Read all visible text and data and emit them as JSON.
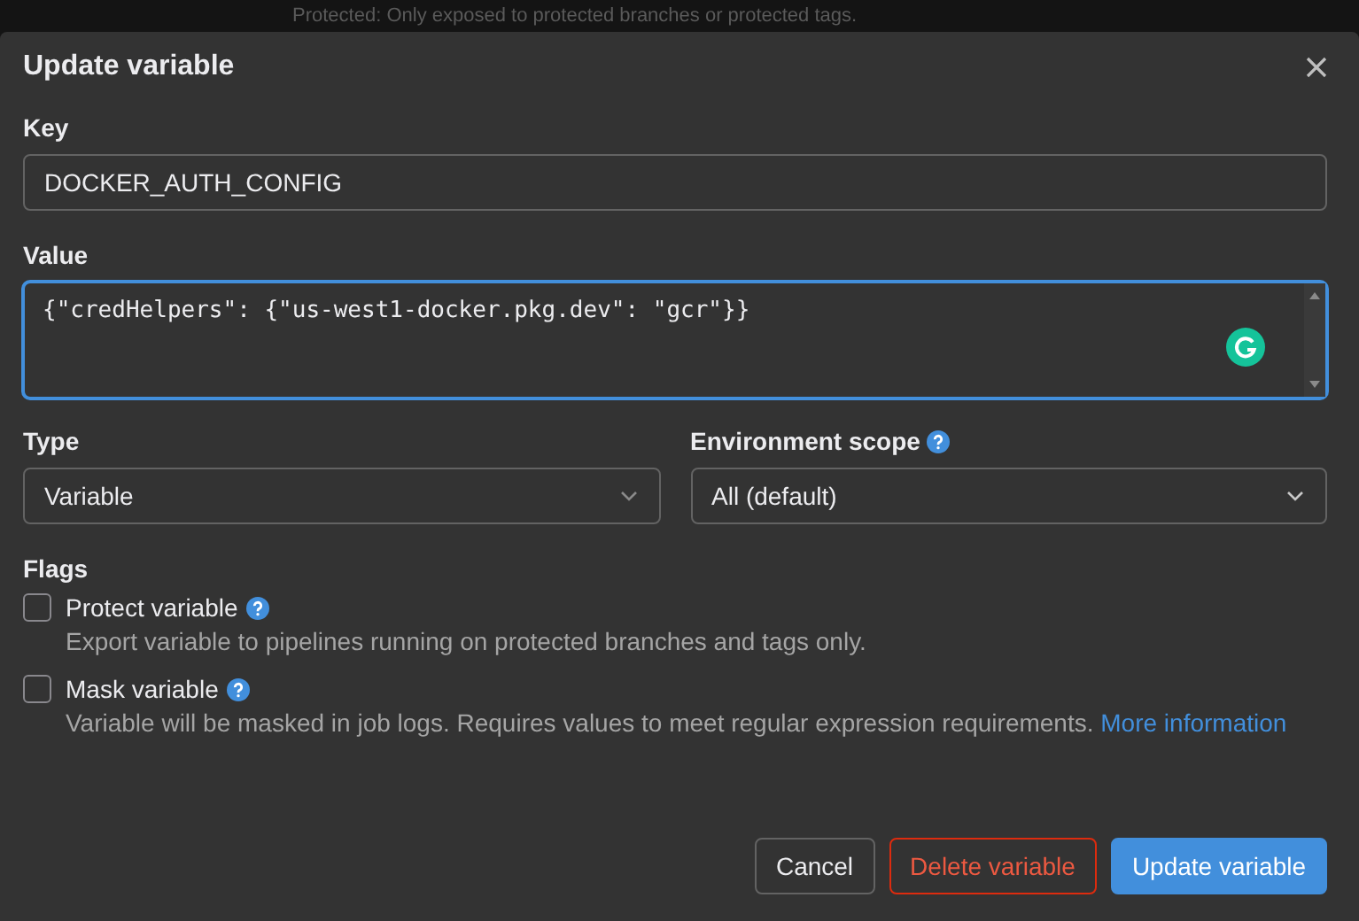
{
  "background_text": "Protected: Only exposed to protected branches or protected tags.",
  "dialog": {
    "title": "Update variable",
    "key": {
      "label": "Key",
      "value": "DOCKER_AUTH_CONFIG"
    },
    "value": {
      "label": "Value",
      "value": "{\"credHelpers\": {\"us-west1-docker.pkg.dev\": \"gcr\"}}"
    },
    "type": {
      "label": "Type",
      "value": "Variable"
    },
    "environment_scope": {
      "label": "Environment scope",
      "value": "All (default)"
    },
    "flags": {
      "label": "Flags",
      "items": [
        {
          "label": "Protect variable",
          "checked": false,
          "description": "Export variable to pipelines running on protected branches and tags only."
        },
        {
          "label": "Mask variable",
          "checked": false,
          "description": "Variable will be masked in job logs. Requires values to meet regular expression requirements.",
          "link": "More information"
        }
      ]
    },
    "buttons": [
      {
        "label": "Cancel",
        "kind": "default"
      },
      {
        "label": "Delete variable",
        "kind": "danger"
      },
      {
        "label": "Update variable",
        "kind": "confirm"
      }
    ]
  }
}
